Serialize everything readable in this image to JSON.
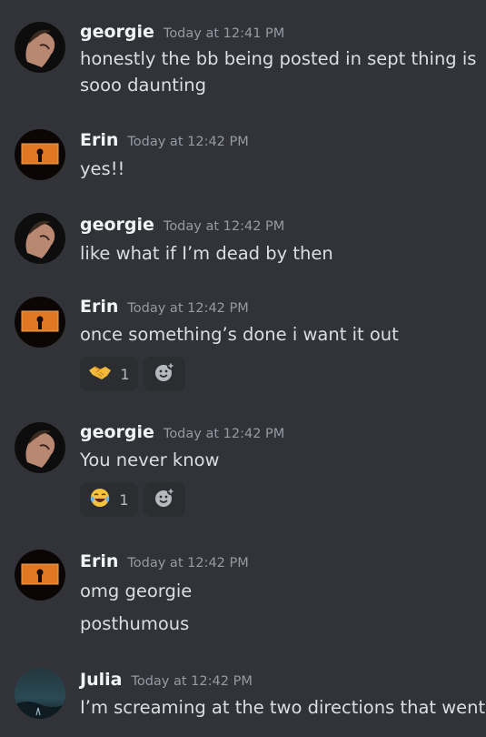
{
  "messages": [
    {
      "user": "georgie",
      "time": "Today at 12:41 PM",
      "lines": [
        "honestly the bb being posted in sept thing is",
        "sooo daunting"
      ]
    },
    {
      "user": "Erin",
      "time": "Today at 12:42 PM",
      "lines": [
        "yes!!"
      ]
    },
    {
      "user": "georgie",
      "time": "Today at 12:42 PM",
      "lines": [
        "like what if I’m dead by then"
      ]
    },
    {
      "user": "Erin",
      "time": "Today at 12:42 PM",
      "lines": [
        "once something’s done i want it out"
      ],
      "reaction": {
        "emoji": "handshake",
        "count": "1"
      }
    },
    {
      "user": "georgie",
      "time": "Today at 12:42 PM",
      "lines": [
        "You never know"
      ],
      "reaction": {
        "emoji": "joy",
        "count": "1"
      }
    },
    {
      "user": "Erin",
      "time": "Today at 12:42 PM",
      "lines": [
        "omg georgie",
        "posthumous"
      ]
    },
    {
      "user": "Julia",
      "time": "Today at 12:42 PM",
      "lines": [
        "I’m screaming at the two directions that went"
      ]
    }
  ],
  "icons": {
    "add_reaction": "add-reaction-icon"
  },
  "colors": {
    "background": "#313338",
    "reaction_bg": "#2b2d31",
    "timestamp": "#949ba4"
  }
}
